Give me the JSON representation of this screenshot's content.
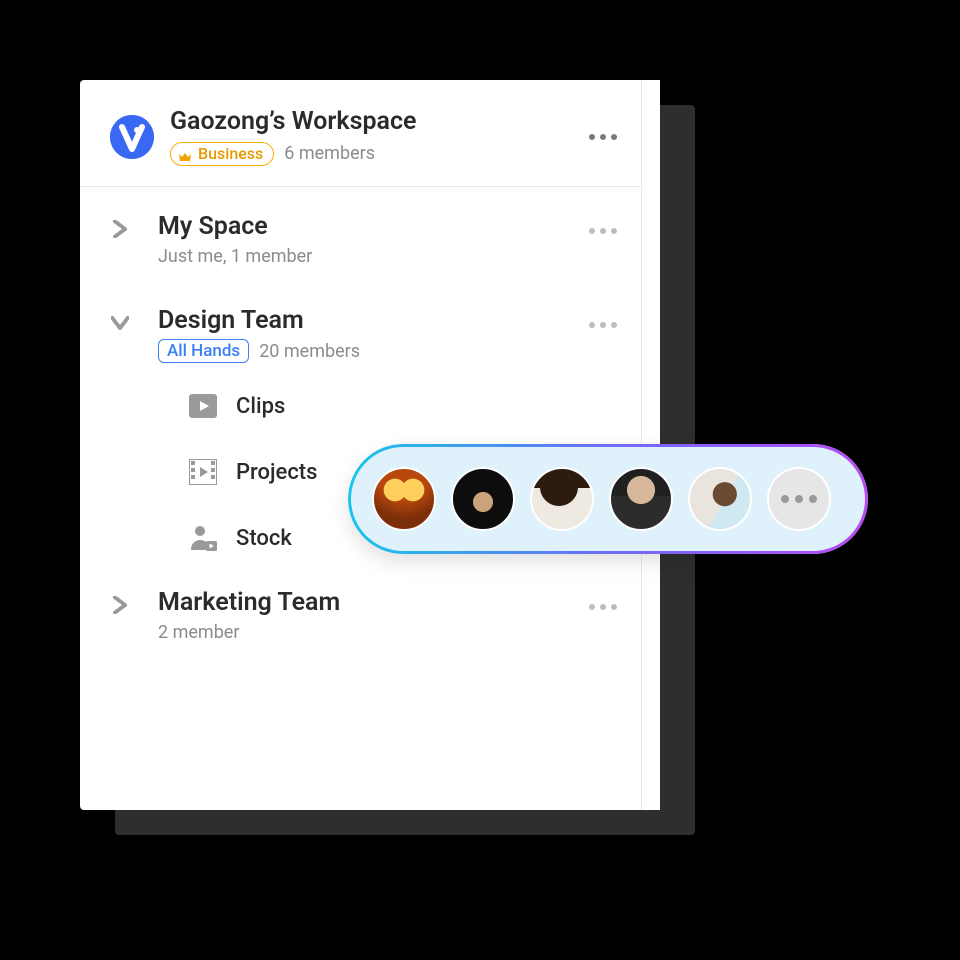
{
  "workspace": {
    "title": "Gaozong’s Workspace",
    "plan_badge": "Business",
    "member_text": "6 members"
  },
  "teams": [
    {
      "name": "My Space",
      "subtitle": "Just me, 1 member",
      "expanded": false,
      "tag": null,
      "children": []
    },
    {
      "name": "Design Team",
      "subtitle": "20 members",
      "expanded": true,
      "tag": "All Hands",
      "children": [
        {
          "label": "Clips",
          "icon": "play"
        },
        {
          "label": "Projects",
          "icon": "film"
        },
        {
          "label": "Stock",
          "icon": "person-play"
        }
      ]
    },
    {
      "name": "Marketing Team",
      "subtitle": "2 member",
      "expanded": false,
      "tag": null,
      "children": []
    }
  ],
  "avatar_pill": {
    "count_visible": 5,
    "has_more": true
  }
}
